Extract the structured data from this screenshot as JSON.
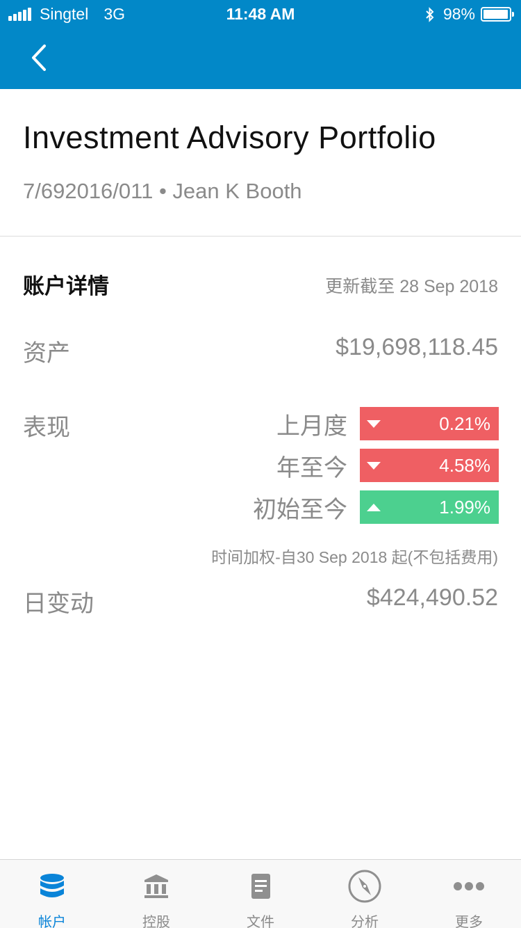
{
  "status_bar": {
    "carrier": "Singtel",
    "network": "3G",
    "time": "11:48 AM",
    "battery_percent": "98%",
    "battery_level": 0.98
  },
  "colors": {
    "brand": "#0288c8",
    "negative": "#ef5f63",
    "positive": "#4cd08f",
    "tab_active": "#0a84d8"
  },
  "navbar": {
    "back_icon": "chevron-left-icon"
  },
  "header": {
    "title": "Investment Advisory Portfolio",
    "subtitle": "7/692016/011 • Jean K Booth"
  },
  "account_details": {
    "section_title": "账户详情",
    "updated": "更新截至 28 Sep 2018",
    "assets_label": "资产",
    "assets_value": "$19,698,118.45",
    "performance_label": "表现",
    "performance": [
      {
        "label": "上月度",
        "value": "0.21%",
        "direction": "down"
      },
      {
        "label": "年至今",
        "value": "4.58%",
        "direction": "down"
      },
      {
        "label": "初始至今",
        "value": "1.99%",
        "direction": "up"
      }
    ],
    "footnote": "时间加权-自30 Sep 2018 起(不包括费用)",
    "daily_change_label": "日变动",
    "daily_change_value": "$424,490.52"
  },
  "tabbar": {
    "tabs": [
      {
        "label": "帐户",
        "icon": "database-icon",
        "active": true
      },
      {
        "label": "控股",
        "icon": "bank-icon",
        "active": false
      },
      {
        "label": "文件",
        "icon": "document-icon",
        "active": false
      },
      {
        "label": "分析",
        "icon": "compass-icon",
        "active": false
      },
      {
        "label": "更多",
        "icon": "more-dots-icon",
        "active": false
      }
    ]
  }
}
